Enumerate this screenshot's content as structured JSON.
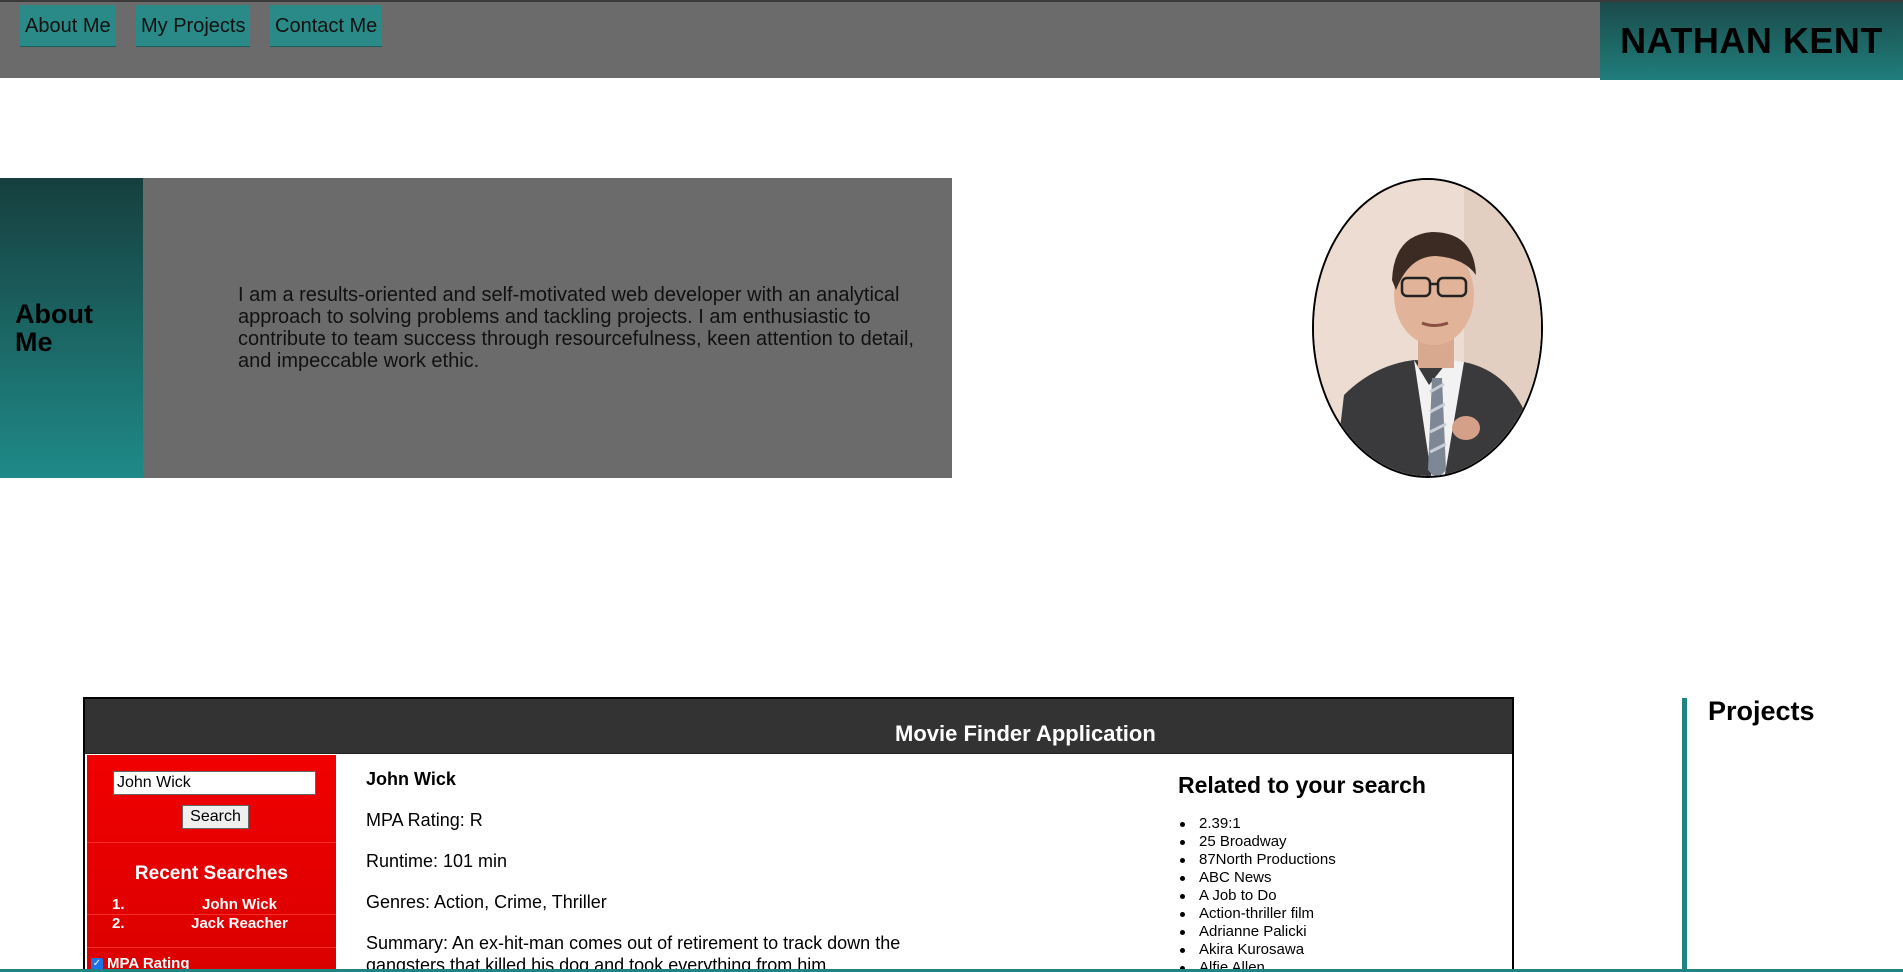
{
  "nav": {
    "links": [
      {
        "label": "About Me"
      },
      {
        "label": "My Projects"
      },
      {
        "label": "Contact Me"
      }
    ],
    "brand": "NATHAN KENT"
  },
  "about": {
    "title": "About Me",
    "text": "I am a results-oriented and self-motivated web developer with an analytical approach to solving problems and tackling projects. I am enthusiastic to contribute to team success through resourcefulness, keen attention to detail, and impeccable work ethic."
  },
  "projects": {
    "heading": "Projects"
  },
  "app": {
    "title": "Movie Finder Application",
    "search": {
      "value": "John Wick",
      "button": "Search"
    },
    "recent": {
      "title": "Recent Searches",
      "items": [
        {
          "num": "1.",
          "name": "John Wick"
        },
        {
          "num": "2.",
          "name": "Jack Reacher"
        }
      ]
    },
    "filter": {
      "label": "MPA Rating",
      "checked": true
    },
    "movie": {
      "title": "John Wick",
      "rating": "MPA Rating: R",
      "runtime": "Runtime: 101 min",
      "genres": "Genres: Action, Crime, Thriller",
      "summary": "Summary: An ex-hit-man comes out of retirement to track down the gangsters that killed his dog and took everything from him."
    },
    "related": {
      "title": "Related to your search",
      "items": [
        "2.39:1",
        "25 Broadway",
        "87North Productions",
        "ABC News",
        "A Job to Do",
        "Action-thriller film",
        "Adrianne Palicki",
        "Akira Kurosawa",
        "Alfie Allen"
      ]
    }
  },
  "colors": {
    "teal": "#1f8a88",
    "gray": "#6b6b6b",
    "app_red": "#f10000",
    "app_header": "#333333"
  }
}
